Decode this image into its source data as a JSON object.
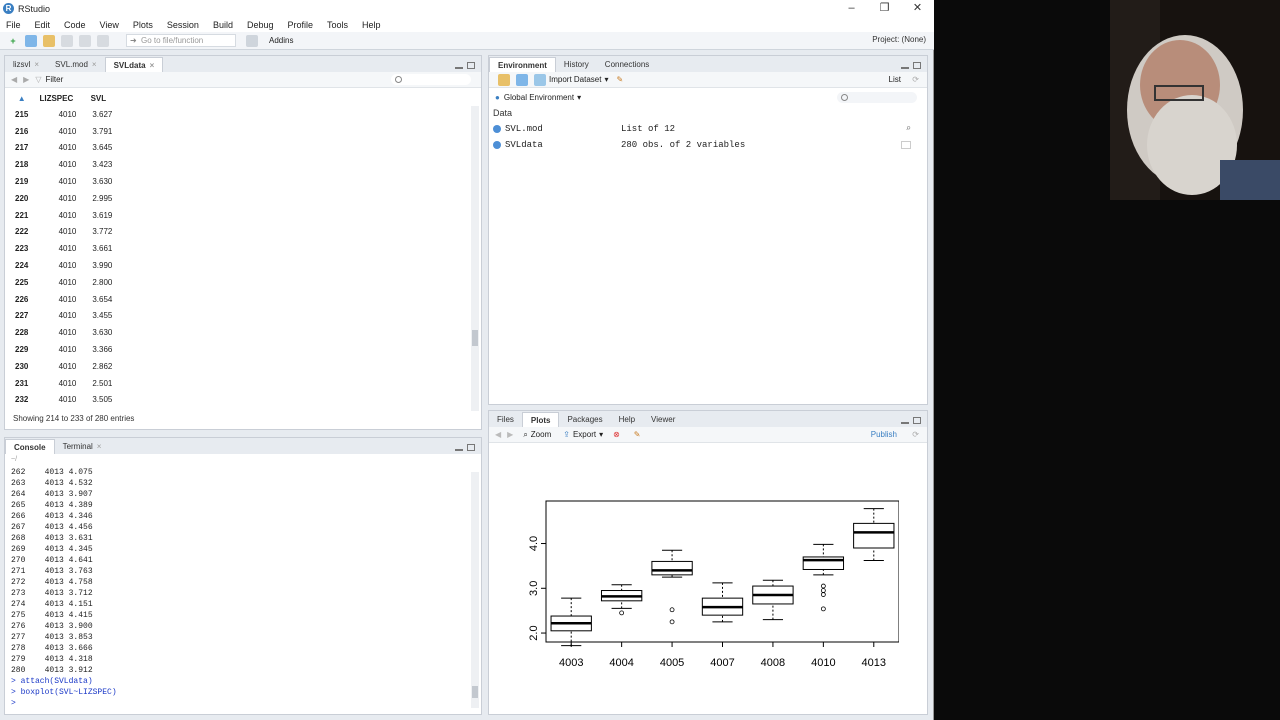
{
  "window": {
    "title": "RStudio",
    "controls": [
      "–",
      "❐",
      "✕"
    ]
  },
  "menu": [
    "File",
    "Edit",
    "Code",
    "View",
    "Plots",
    "Session",
    "Build",
    "Debug",
    "Profile",
    "Tools",
    "Help"
  ],
  "toolbar": {
    "goto_placeholder": "Go to file/function",
    "addins": "Addins",
    "project": "Project: (None)"
  },
  "source_pane": {
    "tabs": [
      "lizsvl",
      "SVL.mod",
      "SVLdata"
    ],
    "filter": "Filter",
    "columns": [
      "",
      "LIZSPEC",
      "SVL"
    ],
    "rows": [
      [
        "215",
        "4010",
        "3.627"
      ],
      [
        "216",
        "4010",
        "3.791"
      ],
      [
        "217",
        "4010",
        "3.645"
      ],
      [
        "218",
        "4010",
        "3.423"
      ],
      [
        "219",
        "4010",
        "3.630"
      ],
      [
        "220",
        "4010",
        "2.995"
      ],
      [
        "221",
        "4010",
        "3.619"
      ],
      [
        "222",
        "4010",
        "3.772"
      ],
      [
        "223",
        "4010",
        "3.661"
      ],
      [
        "224",
        "4010",
        "3.990"
      ],
      [
        "225",
        "4010",
        "2.800"
      ],
      [
        "226",
        "4010",
        "3.654"
      ],
      [
        "227",
        "4010",
        "3.455"
      ],
      [
        "228",
        "4010",
        "3.630"
      ],
      [
        "229",
        "4010",
        "3.366"
      ],
      [
        "230",
        "4010",
        "2.862"
      ],
      [
        "231",
        "4010",
        "2.501"
      ],
      [
        "232",
        "4010",
        "3.505"
      ]
    ],
    "status": "Showing 214 to 233 of 280 entries"
  },
  "console_pane": {
    "tabs": [
      "Console",
      "Terminal"
    ],
    "path": "~/",
    "lines": [
      "262    4013 4.075",
      "263    4013 4.532",
      "264    4013 3.907",
      "265    4013 4.389",
      "266    4013 4.346",
      "267    4013 4.456",
      "268    4013 3.631",
      "269    4013 4.345",
      "270    4013 4.641",
      "271    4013 3.763",
      "272    4013 4.758",
      "273    4013 3.712",
      "274    4013 4.151",
      "275    4013 4.415",
      "276    4013 3.900",
      "277    4013 3.853",
      "278    4013 3.666",
      "279    4013 4.318",
      "280    4013 3.912"
    ],
    "commands": [
      "> attach(SVLdata)",
      "> boxplot(SVL~LIZSPEC)",
      ">"
    ]
  },
  "env_pane": {
    "tabs": [
      "Environment",
      "History",
      "Connections"
    ],
    "import_label": "Import Dataset",
    "list_label": "List",
    "scope": "Global Environment",
    "section": "Data",
    "objects": [
      {
        "name": "SVL.mod",
        "value": "List of 12"
      },
      {
        "name": "SVLdata",
        "value": "280 obs. of 2 variables"
      }
    ]
  },
  "plots_pane": {
    "tabs": [
      "Files",
      "Plots",
      "Packages",
      "Help",
      "Viewer"
    ],
    "zoom": "Zoom",
    "export": "Export",
    "publish": "Publish"
  },
  "chart_data": {
    "type": "boxplot",
    "categories": [
      "4003",
      "4004",
      "4005",
      "4007",
      "4008",
      "4010",
      "4013"
    ],
    "y_ticks": [
      "2.0",
      "3.0",
      "4.0"
    ],
    "ylim": [
      1.8,
      4.95
    ],
    "boxes": [
      {
        "min": 1.72,
        "q1": 2.05,
        "median": 2.22,
        "q3": 2.38,
        "max": 2.78,
        "outliers": []
      },
      {
        "min": 2.55,
        "q1": 2.72,
        "median": 2.82,
        "q3": 2.95,
        "max": 3.08,
        "outliers": [
          2.45
        ]
      },
      {
        "min": 3.25,
        "q1": 3.3,
        "median": 3.4,
        "q3": 3.6,
        "max": 3.85,
        "outliers": [
          2.52,
          2.25
        ]
      },
      {
        "min": 2.25,
        "q1": 2.4,
        "median": 2.58,
        "q3": 2.78,
        "max": 3.12,
        "outliers": []
      },
      {
        "min": 2.3,
        "q1": 2.65,
        "median": 2.85,
        "q3": 3.05,
        "max": 3.18,
        "outliers": []
      },
      {
        "min": 3.3,
        "q1": 3.42,
        "median": 3.63,
        "q3": 3.7,
        "max": 3.98,
        "outliers": [
          3.05,
          2.95,
          2.86,
          2.54
        ]
      },
      {
        "min": 3.62,
        "q1": 3.9,
        "median": 4.25,
        "q3": 4.45,
        "max": 4.78,
        "outliers": []
      }
    ]
  }
}
